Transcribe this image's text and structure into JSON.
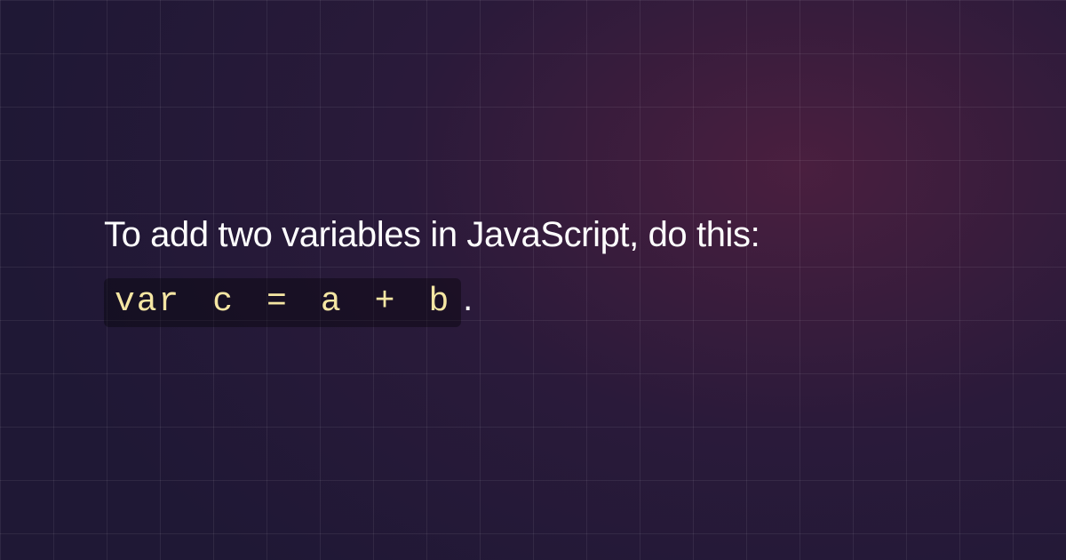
{
  "intro_text": "To add two variables in JavaScript, do this:",
  "code_snippet": "var c = a + b",
  "period": "."
}
